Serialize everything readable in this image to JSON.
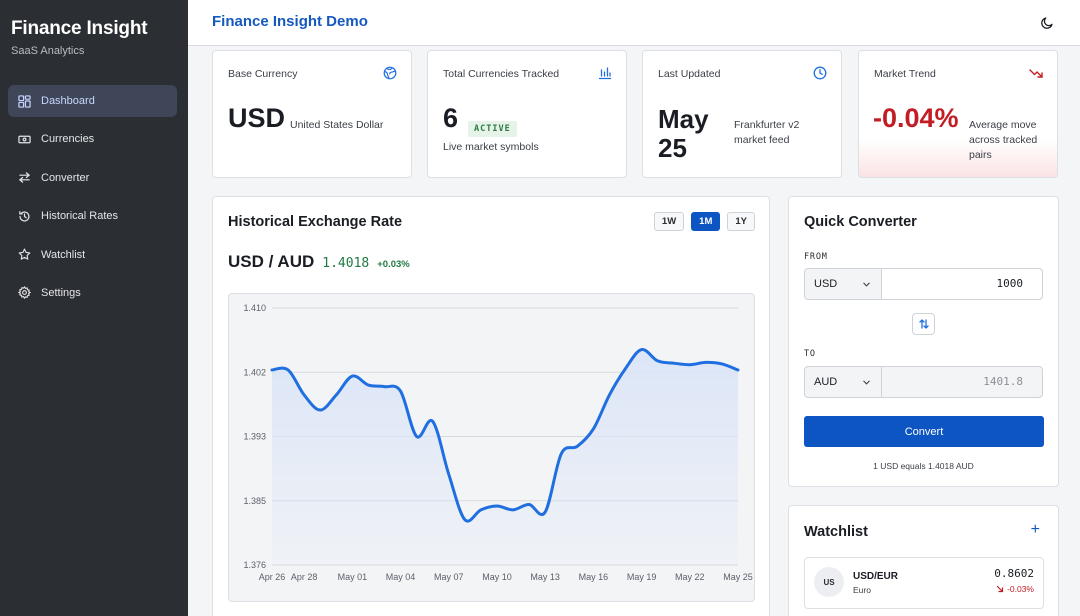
{
  "brand": {
    "title": "Finance Insight",
    "subtitle": "SaaS Analytics"
  },
  "sidebar": {
    "items": [
      {
        "label": "Dashboard",
        "icon": "grid-icon",
        "active": true
      },
      {
        "label": "Currencies",
        "icon": "banknote-icon"
      },
      {
        "label": "Converter",
        "icon": "arrows-exchange-icon"
      },
      {
        "label": "Historical Rates",
        "icon": "history-icon"
      },
      {
        "label": "Watchlist",
        "icon": "star-icon"
      },
      {
        "label": "Settings",
        "icon": "gear-icon"
      }
    ]
  },
  "header": {
    "title": "Finance Insight Demo",
    "theme_icon": "moon-icon"
  },
  "stats": {
    "base_currency": {
      "label": "Base Currency",
      "value": "USD",
      "detail": "United States Dollar",
      "icon": "globe-icon"
    },
    "tracked": {
      "label": "Total Currencies Tracked",
      "value": "6",
      "badge": "ACTIVE",
      "detail": "Live market symbols",
      "icon": "bar-chart-icon"
    },
    "updated": {
      "label": "Last Updated",
      "value_line1": "May",
      "value_line2": "25",
      "detail": "Frankfurter v2 market feed",
      "icon": "clock-icon"
    },
    "trend": {
      "label": "Market Trend",
      "value": "-0.04%",
      "detail": "Average move across tracked pairs",
      "icon": "trending-down-icon"
    }
  },
  "chart_panel": {
    "title": "Historical Exchange Rate",
    "ranges": [
      "1W",
      "1M",
      "1Y"
    ],
    "active_range": "1M",
    "pair": "USD / AUD",
    "rate": "1.4018",
    "change": "+0.03%"
  },
  "chart_data": {
    "type": "area",
    "title": "",
    "xlabel": "",
    "ylabel": "",
    "ylim": [
      1.376,
      1.41
    ],
    "yticks": [
      "1.410",
      "1.402",
      "1.393",
      "1.385",
      "1.376"
    ],
    "xticks": [
      "Apr 26",
      "Apr 28",
      "May 01",
      "May 04",
      "May 07",
      "May 10",
      "May 13",
      "May 16",
      "May 19",
      "May 22",
      "May 25"
    ],
    "x": [
      "Apr 26",
      "Apr 27",
      "Apr 28",
      "Apr 29",
      "Apr 30",
      "May 01",
      "May 02",
      "May 03",
      "May 04",
      "May 05",
      "May 06",
      "May 07",
      "May 08",
      "May 09",
      "May 10",
      "May 11",
      "May 12",
      "May 13",
      "May 14",
      "May 15",
      "May 16",
      "May 17",
      "May 18",
      "May 19",
      "May 20",
      "May 21",
      "May 22",
      "May 23",
      "May 24",
      "May 25"
    ],
    "series": [
      {
        "values": [
          1.4018,
          1.4018,
          1.3985,
          1.3965,
          1.3985,
          1.401,
          1.3998,
          1.3996,
          1.399,
          1.393,
          1.395,
          1.388,
          1.382,
          1.3833,
          1.3838,
          1.3833,
          1.384,
          1.383,
          1.3907,
          1.3917,
          1.394,
          1.3985,
          1.402,
          1.4045,
          1.403,
          1.4027,
          1.4025,
          1.4028,
          1.4026,
          1.4018
        ]
      }
    ],
    "grid": true,
    "line_color": "#1f6fe0",
    "fill_color": "#dbe5f7"
  },
  "converter": {
    "title": "Quick Converter",
    "from_label": "FROM",
    "to_label": "TO",
    "from_currency": "USD",
    "to_currency": "AUD",
    "amount": "1000",
    "result": "1401.8",
    "button_label": "Convert",
    "note": "1 USD equals 1.4018 AUD"
  },
  "watchlist": {
    "title": "Watchlist",
    "add_label": "+",
    "items": [
      {
        "avatar": "US",
        "pair": "USD/EUR",
        "name": "Euro",
        "rate": "0.8602",
        "change": "-0.03%"
      }
    ]
  },
  "colors": {
    "accent": "#0d55c2",
    "sidebar_bg": "#2b2e33",
    "positive": "#1f7a43",
    "negative": "#c21d24"
  }
}
